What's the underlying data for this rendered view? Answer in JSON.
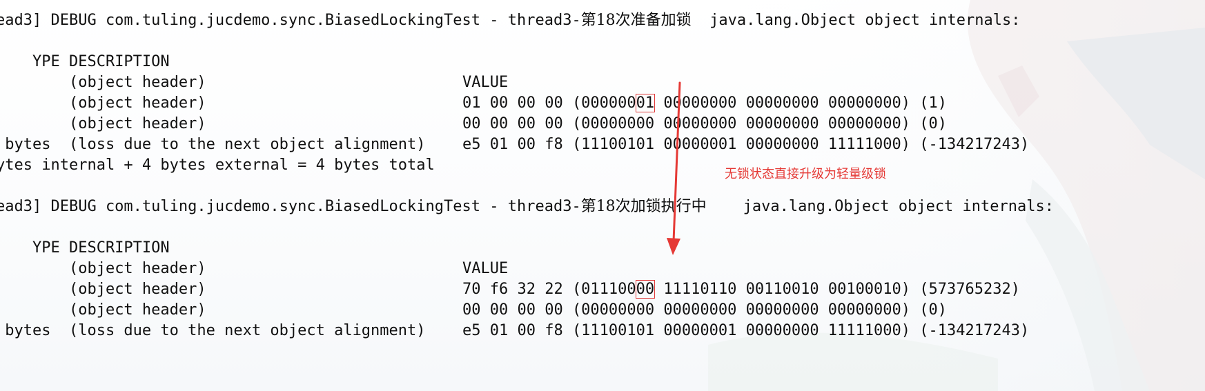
{
  "block1": {
    "log_line": "ead3] DEBUG com.tuling.jucdemo.sync.BiasedLockingTest - thread3-",
    "log_line_cjk": "第18次准备加锁",
    "log_line_tail": "  java.lang.Object object internals:",
    "header_left": "YPE DESCRIPTION",
    "header_right": "VALUE",
    "rows": [
      {
        "desc": "    (object header)",
        "v_pre": "01 00 00 00 (000000",
        "v_hl": "01",
        "v_post": " 00000000 00000000 00000000) (1)"
      },
      {
        "desc": "    (object header)",
        "value": "00 00 00 00 (00000000 00000000 00000000 00000000) (0)"
      },
      {
        "desc": "    (object header)",
        "value": "e5 01 00 f8 (11100101 00000001 00000000 11111000) (-134217243)"
      },
      {
        "desc": "    (loss due to the next object alignment)"
      }
    ],
    "size_line": " bytes",
    "space_line": "ytes internal + 4 bytes external = 4 bytes total"
  },
  "annotation": "无锁状态直接升级为轻量级锁",
  "block2": {
    "log_line": "ead3] DEBUG com.tuling.jucdemo.sync.BiasedLockingTest - thread3-",
    "log_line_cjk": "第18次加锁执行中",
    "log_line_tail": "    java.lang.Object object internals:",
    "header_left": "YPE DESCRIPTION",
    "header_right": "VALUE",
    "rows": [
      {
        "desc": "    (object header)",
        "v_pre": "70 f6 32 22 (011100",
        "v_hl": "00",
        "v_post": " 11110110 00110010 00100010) (573765232)"
      },
      {
        "desc": "    (object header)",
        "value": "00 00 00 00 (00000000 00000000 00000000 00000000) (0)"
      },
      {
        "desc": "    (object header)",
        "value": "e5 01 00 f8 (11100101 00000001 00000000 11111000) (-134217243)"
      },
      {
        "desc": "    (loss due to the next object alignment)"
      }
    ],
    "size_line": " bytes"
  },
  "colors": {
    "annotation": "#e53935",
    "highlight_box": "#e03b3b",
    "arrow": "#e53935",
    "text": "#111111"
  }
}
